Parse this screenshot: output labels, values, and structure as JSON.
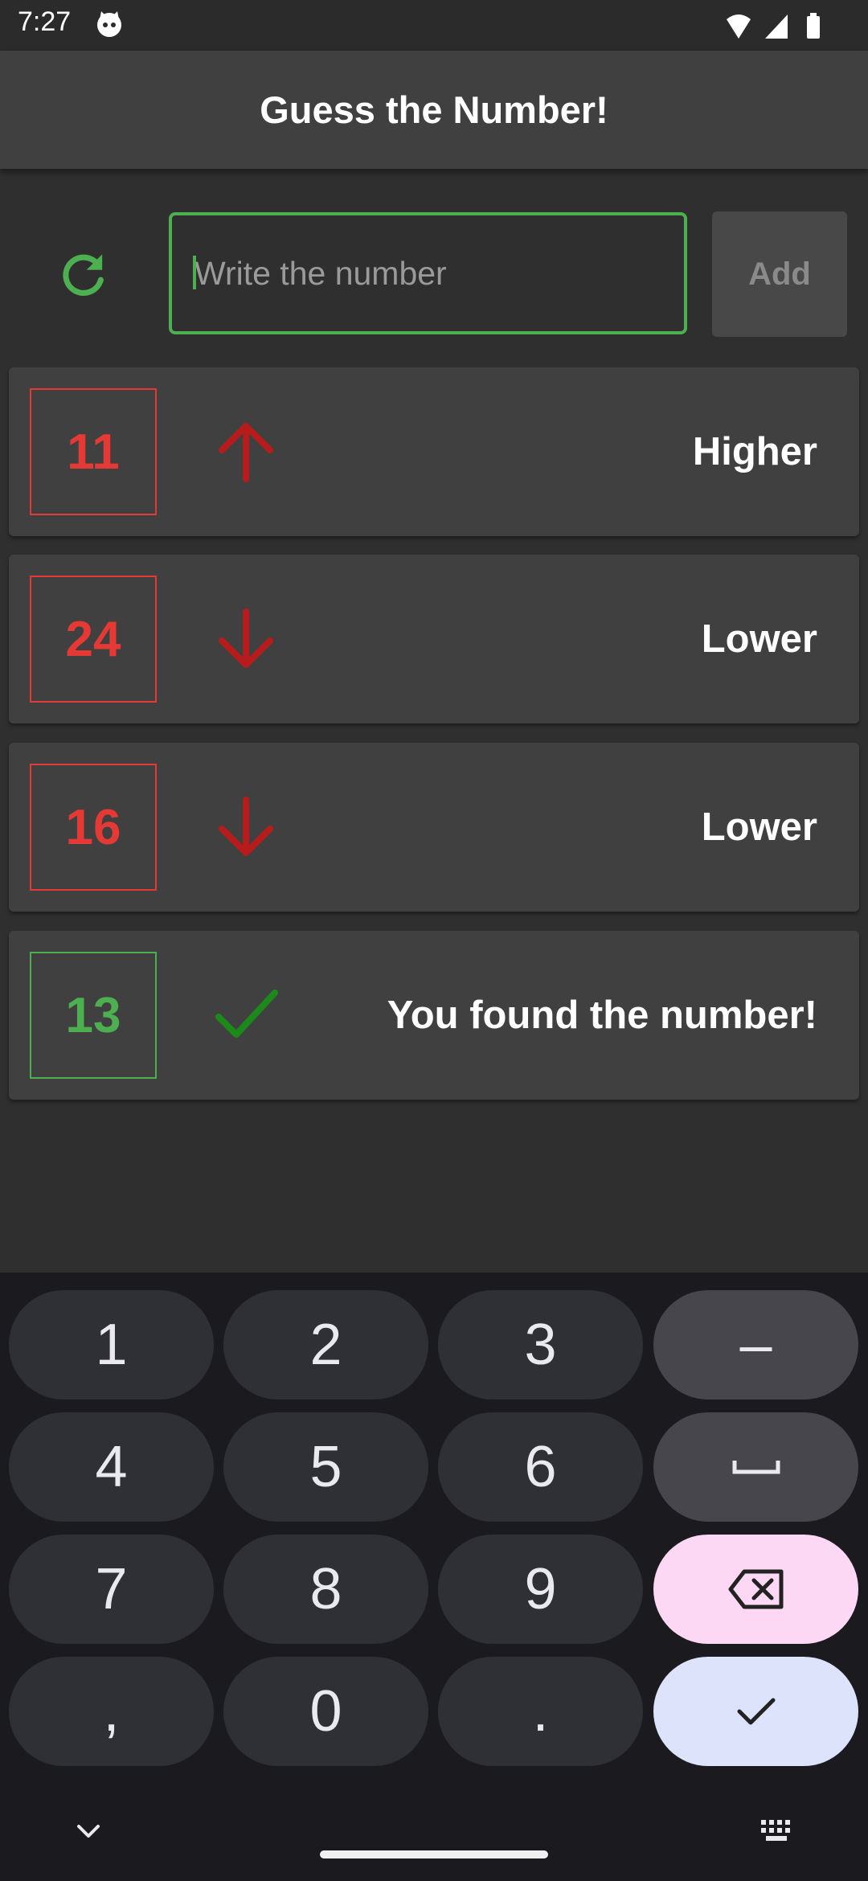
{
  "status_bar": {
    "time": "7:27"
  },
  "app_bar": {
    "title": "Guess the Number!"
  },
  "input": {
    "placeholder": "Write the number",
    "value": ""
  },
  "add_button": {
    "label": "Add"
  },
  "guesses": [
    {
      "number": "11",
      "hint": "Higher",
      "direction": "up"
    },
    {
      "number": "24",
      "hint": "Lower",
      "direction": "down"
    },
    {
      "number": "16",
      "hint": "Lower",
      "direction": "down"
    },
    {
      "number": "13",
      "hint": "You found the number!",
      "direction": "found"
    }
  ],
  "keyboard": {
    "digits": [
      "1",
      "2",
      "3",
      "4",
      "5",
      "6",
      "7",
      "8",
      "9",
      "0"
    ],
    "minus": "–",
    "comma": ",",
    "period": "."
  },
  "colors": {
    "accent_green": "#4caf50",
    "error_red": "#e53935",
    "arrow_red": "#b71c1c",
    "check_green": "#1b8a1b"
  }
}
